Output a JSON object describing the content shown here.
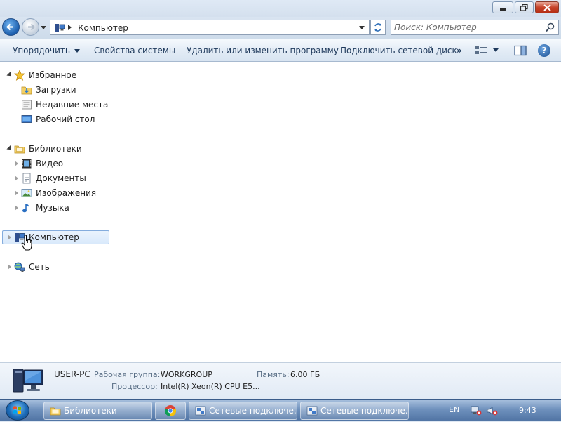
{
  "window": {
    "minimize_icon": "minimize-icon",
    "maximize_icon": "restore-icon",
    "close_icon": "close-icon"
  },
  "address": {
    "path": "Компьютер",
    "search_placeholder": "Поиск: Компьютер"
  },
  "toolbar": {
    "organize": "Упорядочить",
    "system_properties": "Свойства системы",
    "uninstall": "Удалить или изменить программу",
    "map_drive": "Подключить сетевой диск",
    "more": "»"
  },
  "nav": {
    "favorites": "Избранное",
    "downloads": "Загрузки",
    "recent": "Недавние места",
    "desktop": "Рабочий стол",
    "libraries": "Библиотеки",
    "video": "Видео",
    "documents": "Документы",
    "images": "Изображения",
    "music": "Музыка",
    "computer": "Компьютер",
    "network": "Сеть"
  },
  "details": {
    "pc_name": "USER-PC",
    "workgroup_label": "Рабочая группа:",
    "workgroup_value": "WORKGROUP",
    "memory_label": "Память:",
    "memory_value": "6.00 ГБ",
    "cpu_label": "Процессор:",
    "cpu_value": "Intel(R) Xeon(R) CPU E5..."
  },
  "taskbar": {
    "item1": "Библиотеки",
    "item3": "Сетевые подключе...",
    "item4": "Сетевые подключе...",
    "lang": "EN",
    "time": "9:43"
  },
  "colors": {
    "accent": "#1e395b",
    "selection": "#d9e9fb"
  }
}
